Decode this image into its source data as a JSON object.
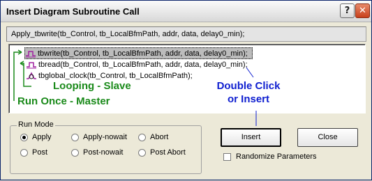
{
  "window": {
    "title": "Insert Diagram Subroutine Call",
    "help_glyph": "?",
    "close_glyph": "✕"
  },
  "call_text": "Apply_tbwrite(tb_Control, tb_LocalBfmPath, addr, data, delay0_min);",
  "tree": [
    {
      "label": "tbwrite(tb_Control, tb_LocalBfmPath, addr, data, delay0_min);",
      "icon": "write-waveform-icon",
      "selected": true
    },
    {
      "label": "tbread(tb_Control, tb_LocalBfmPath, addr, data, delay0_min);",
      "icon": "read-waveform-icon",
      "selected": false
    },
    {
      "label": "tbglobal_clock(tb_Control, tb_LocalBfmPath);",
      "icon": "clock-waveform-icon",
      "selected": false
    }
  ],
  "annotations": {
    "looping": "Looping - Slave",
    "run_once": "Run Once - Master",
    "double_click_line1": "Double Click",
    "double_click_line2": "or Insert",
    "green": "#1a8a1a",
    "blue": "#1020d0"
  },
  "run_mode": {
    "label": "Run Mode",
    "options": [
      "Apply",
      "Apply-nowait",
      "Abort",
      "Post",
      "Post-nowait",
      "Post Abort"
    ],
    "selected": "Apply"
  },
  "buttons": {
    "insert": "Insert",
    "close": "Close"
  },
  "randomize": {
    "label": "Randomize Parameters",
    "checked": false
  }
}
